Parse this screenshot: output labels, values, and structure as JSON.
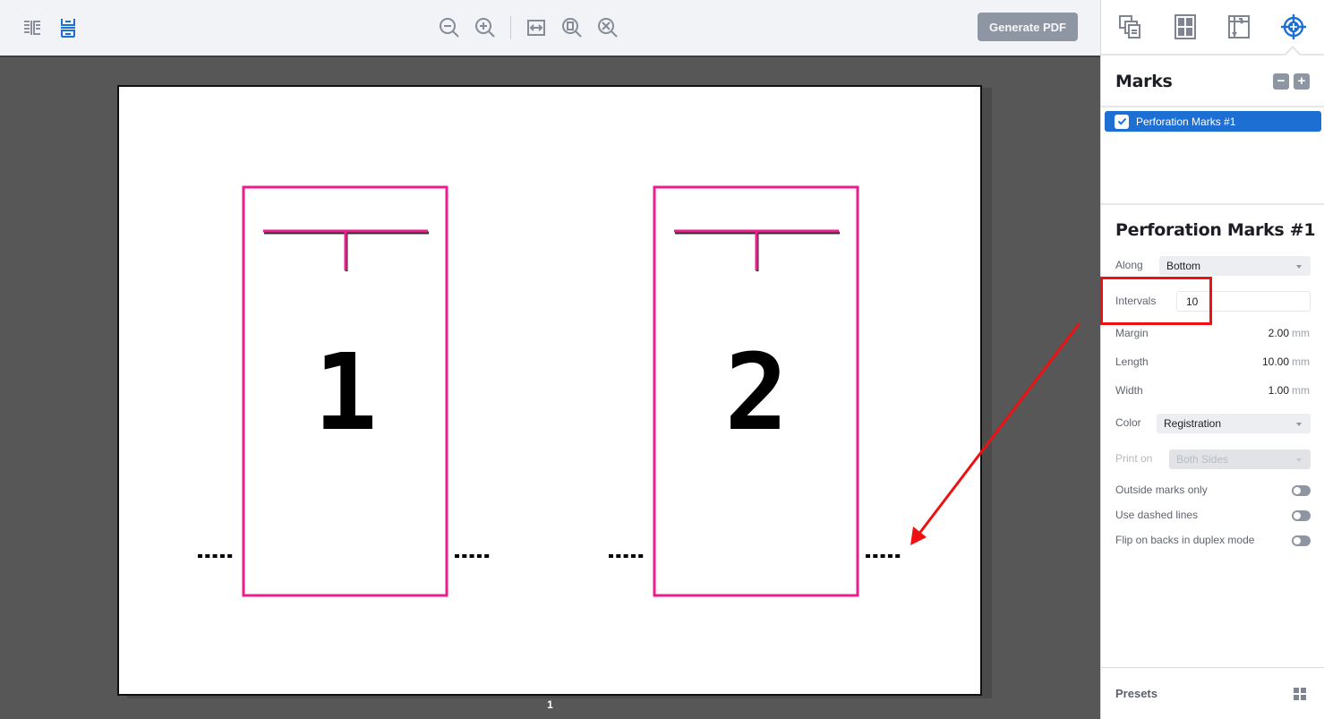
{
  "toolbar": {
    "view_icons": [
      {
        "name": "side-by-side-view-icon",
        "active": false
      },
      {
        "name": "stacked-view-icon",
        "active": true
      }
    ],
    "zoom_icons": [
      "zoom-out-icon",
      "zoom-in-icon",
      "fit-width-icon",
      "zoom-actual-icon",
      "zoom-fit-icon"
    ],
    "generate_pdf_label": "Generate PDF"
  },
  "panel_tabs": [
    {
      "name": "pages-tab-icon",
      "active": false
    },
    {
      "name": "layout-tab-icon",
      "active": false
    },
    {
      "name": "sizing-tab-icon",
      "active": false
    },
    {
      "name": "marks-tab-icon",
      "active": true
    }
  ],
  "marks": {
    "title": "Marks",
    "remove_label": "−",
    "add_label": "+",
    "items": [
      {
        "label": "Perforation Marks #1",
        "checked": true,
        "selected": true
      }
    ]
  },
  "properties": {
    "title": "Perforation Marks #1",
    "along": {
      "label": "Along",
      "value": "Bottom"
    },
    "intervals": {
      "label": "Intervals",
      "value": "10"
    },
    "margin": {
      "label": "Margin",
      "value": "2.00",
      "unit": "mm"
    },
    "length": {
      "label": "Length",
      "value": "10.00",
      "unit": "mm"
    },
    "width": {
      "label": "Width",
      "value": "1.00",
      "unit": "mm"
    },
    "color": {
      "label": "Color",
      "value": "Registration"
    },
    "print_on": {
      "label": "Print on",
      "value": "Both Sides",
      "disabled": true
    },
    "toggles": [
      {
        "label": "Outside marks only",
        "on": false
      },
      {
        "label": "Use dashed lines",
        "on": false
      },
      {
        "label": "Flip on backs in duplex mode",
        "on": false
      }
    ]
  },
  "presets": {
    "label": "Presets"
  },
  "canvas": {
    "page_number": "1",
    "tiles": [
      {
        "label": "1"
      },
      {
        "label": "2"
      }
    ]
  },
  "colors": {
    "accent": "#1e6fd4",
    "tile_border": "#ee1c8e",
    "annotation": "#ee1111",
    "canvas_bg": "#575757"
  }
}
